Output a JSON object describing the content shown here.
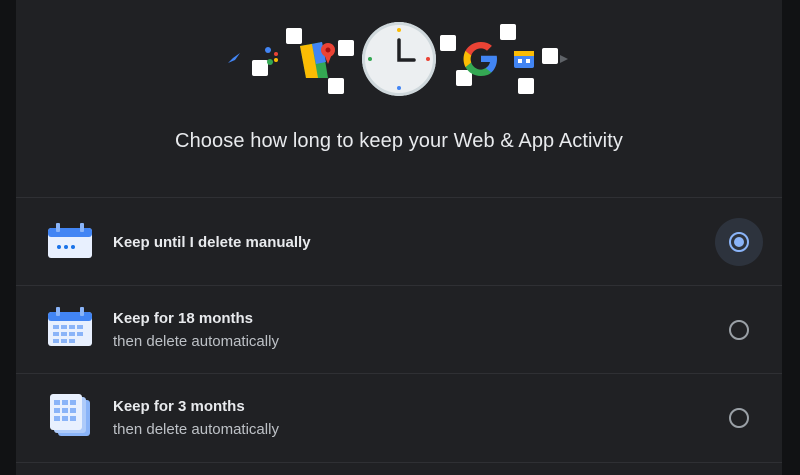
{
  "header": {
    "title": "Choose how long to keep your Web & App Activity",
    "google_letter": "G"
  },
  "options": [
    {
      "title": "Keep until I delete manually",
      "subtitle": "",
      "selected": true,
      "icon": "calendar-icon"
    },
    {
      "title": "Keep for 18 months",
      "subtitle": "then delete automatically",
      "selected": false,
      "icon": "calendar-grid-icon"
    },
    {
      "title": "Keep for 3 months",
      "subtitle": "then delete automatically",
      "selected": false,
      "icon": "calendar-stack-icon"
    }
  ],
  "colors": {
    "accent": "#8ab4f8",
    "background": "#202124",
    "text_primary": "#e8eaed",
    "text_secondary": "#bdc1c6"
  }
}
